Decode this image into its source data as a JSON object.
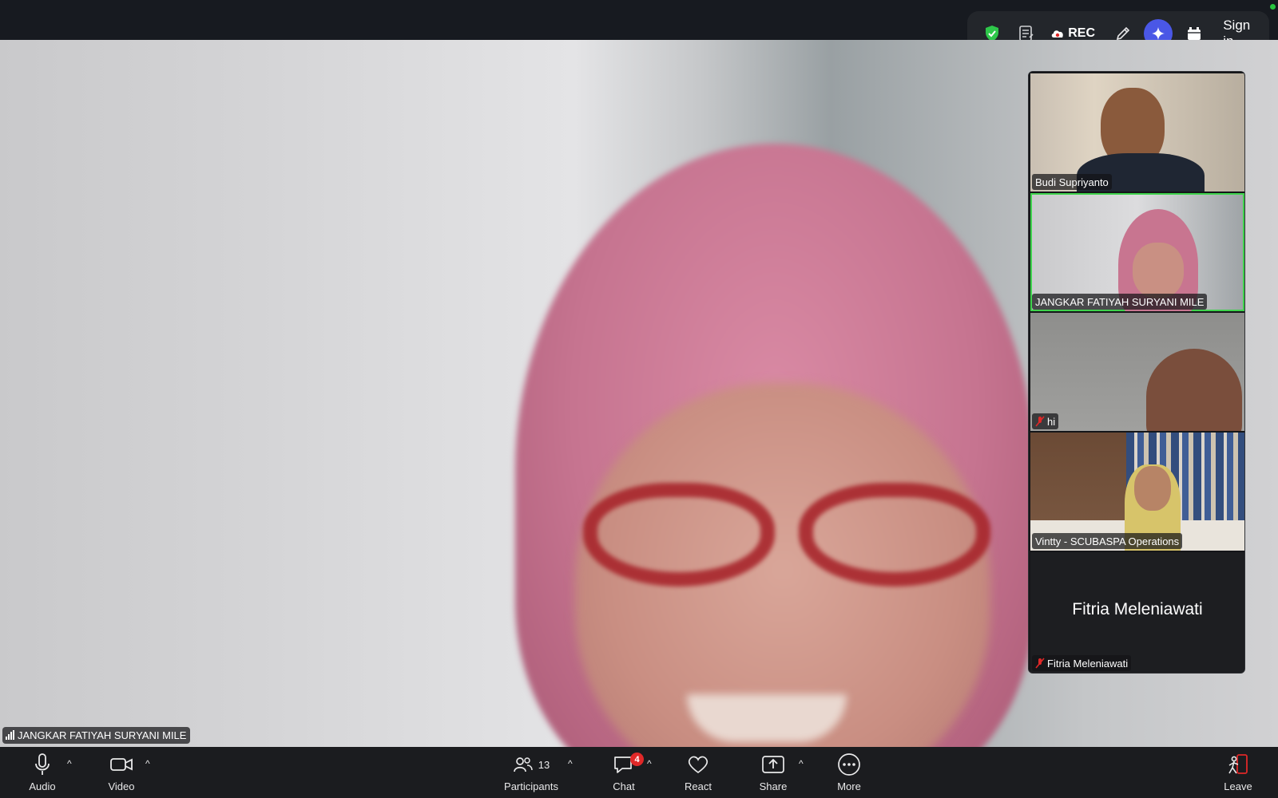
{
  "top_toolbar": {
    "rec_label": "REC",
    "signin_label": "Sign in",
    "icons": [
      "shield-check-icon",
      "notes-icon",
      "cloud-record-icon",
      "pencil-icon",
      "ai-companion-icon",
      "apps-icon"
    ],
    "colors": {
      "shield": "#2ec74a",
      "ai_button": "#4a57e6",
      "status_dot": "#29c43f"
    }
  },
  "main_video": {
    "speaker_name": "JANGKAR FATIYAH SURYANI MILE"
  },
  "gallery": [
    {
      "name": "Budi Supriyanto",
      "muted": false,
      "active": false
    },
    {
      "name": "JANGKAR FATIYAH SURYANI MILE",
      "muted": false,
      "active": true
    },
    {
      "name": "hi",
      "muted": true,
      "active": false
    },
    {
      "name": "Vintty - SCUBASPA Operations",
      "muted": false,
      "active": false
    },
    {
      "name": "Fitria Meleniawati",
      "display_name": "Fitria Meleniawati",
      "muted": true,
      "active": false,
      "video_off": true
    }
  ],
  "controls": {
    "audio": "Audio",
    "video": "Video",
    "participants": "Participants",
    "participants_count": "13",
    "chat": "Chat",
    "chat_badge": "4",
    "react": "React",
    "share": "Share",
    "more": "More",
    "leave": "Leave",
    "colors": {
      "active_border": "#3ed34c",
      "badge": "#e02828",
      "leave_icon": "#e02828"
    }
  }
}
